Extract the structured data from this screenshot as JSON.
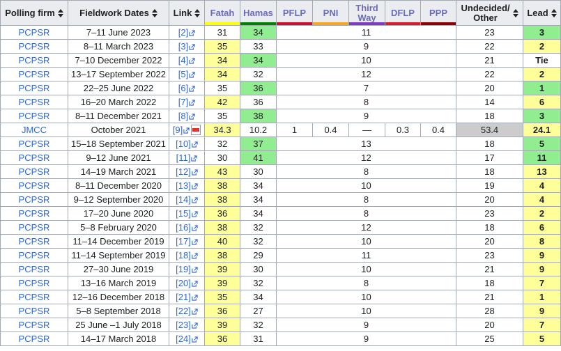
{
  "headers": {
    "firm": "Polling firm",
    "dates": "Fieldwork Dates",
    "link": "Link",
    "fatah": "Fatah",
    "hamas": "Hamas",
    "pflp": "PFLP",
    "pni": "PNI",
    "third_way": "Third Way",
    "dflp": "DFLP",
    "ppp": "PPP",
    "undecided": "Undecided/ Other",
    "lead": "Lead"
  },
  "party_colors": {
    "fatah": "#ffff00",
    "hamas": "#008000",
    "pflp": "#c8102e",
    "pni": "#f5a623",
    "third_way": "#7e3bbd",
    "dflp": "#d41c2a",
    "ppp": "#8b0000"
  },
  "highlight_colors": {
    "fatah": "#ffff99",
    "hamas": "#90ee90",
    "undecided": "#cccccc"
  },
  "rows": [
    {
      "firm": "PCPSR",
      "dates": "7–11 June 2023",
      "link": "[2]",
      "fatah": "31",
      "hamas": "34",
      "others": "11",
      "undecided": "23",
      "lead": "3",
      "leader": "hamas"
    },
    {
      "firm": "PCPSR",
      "dates": "8–11 March 2023",
      "link": "[3]",
      "fatah": "35",
      "hamas": "33",
      "others": "9",
      "undecided": "22",
      "lead": "2",
      "leader": "fatah"
    },
    {
      "firm": "PCPSR",
      "dates": "7–10 December 2022",
      "link": "[4]",
      "fatah": "34",
      "hamas": "34",
      "others": "10",
      "undecided": "21",
      "lead": "Tie",
      "leader": "tie"
    },
    {
      "firm": "PCPSR",
      "dates": "13–17 September 2022",
      "link": "[5]",
      "fatah": "34",
      "hamas": "32",
      "others": "12",
      "undecided": "22",
      "lead": "2",
      "leader": "fatah"
    },
    {
      "firm": "PCPSR",
      "dates": "22–25 June 2022",
      "link": "[6]",
      "fatah": "35",
      "hamas": "36",
      "others": "7",
      "undecided": "20",
      "lead": "1",
      "leader": "hamas"
    },
    {
      "firm": "PCPSR",
      "dates": "16–20 March 2022",
      "link": "[7]",
      "fatah": "42",
      "hamas": "36",
      "others": "8",
      "undecided": "14",
      "lead": "6",
      "leader": "fatah"
    },
    {
      "firm": "PCPSR",
      "dates": "8–11 December 2021",
      "link": "[8]",
      "fatah": "35",
      "hamas": "38",
      "others": "9",
      "undecided": "18",
      "lead": "3",
      "leader": "hamas"
    },
    {
      "firm": "JMCC",
      "dates": "October 2021",
      "link": "[9]",
      "pdf": true,
      "fatah": "34.3",
      "hamas": "10.2",
      "pflp": "1",
      "pni": "0.4",
      "third_way": "—",
      "dflp": "0.3",
      "ppp": "0.4",
      "undecided": "53.4",
      "lead": "24.1",
      "leader": "fatah",
      "split": true
    },
    {
      "firm": "PCPSR",
      "dates": "15–18 September 2021",
      "link": "[10]",
      "fatah": "32",
      "hamas": "37",
      "others": "13",
      "undecided": "18",
      "lead": "5",
      "leader": "hamas"
    },
    {
      "firm": "PCPSR",
      "dates": "9–12 June 2021",
      "link": "[11]",
      "fatah": "30",
      "hamas": "41",
      "others": "12",
      "undecided": "17",
      "lead": "11",
      "leader": "hamas"
    },
    {
      "firm": "PCPSR",
      "dates": "14–19 March 2021",
      "link": "[12]",
      "fatah": "43",
      "hamas": "30",
      "others": "8",
      "undecided": "18",
      "lead": "13",
      "leader": "fatah"
    },
    {
      "firm": "PCPSR",
      "dates": "8–11 December 2020",
      "link": "[13]",
      "fatah": "38",
      "hamas": "34",
      "others": "10",
      "undecided": "19",
      "lead": "4",
      "leader": "fatah"
    },
    {
      "firm": "PCPSR",
      "dates": "9–12 September 2020",
      "link": "[14]",
      "fatah": "38",
      "hamas": "34",
      "others": "8",
      "undecided": "20",
      "lead": "4",
      "leader": "fatah"
    },
    {
      "firm": "PCPSR",
      "dates": "17–20 June 2020",
      "link": "[15]",
      "fatah": "36",
      "hamas": "34",
      "others": "8",
      "undecided": "23",
      "lead": "2",
      "leader": "fatah"
    },
    {
      "firm": "PCPSR",
      "dates": "5–8 February 2020",
      "link": "[16]",
      "fatah": "38",
      "hamas": "32",
      "others": "12",
      "undecided": "18",
      "lead": "6",
      "leader": "fatah"
    },
    {
      "firm": "PCPSR",
      "dates": "11–14 December 2019",
      "link": "[17]",
      "fatah": "40",
      "hamas": "32",
      "others": "10",
      "undecided": "20",
      "lead": "8",
      "leader": "fatah"
    },
    {
      "firm": "PCPSR",
      "dates": "11–14 September 2019",
      "link": "[18]",
      "fatah": "38",
      "hamas": "29",
      "others": "11",
      "undecided": "23",
      "lead": "9",
      "leader": "fatah"
    },
    {
      "firm": "PCPSR",
      "dates": "27–30 June 2019",
      "link": "[19]",
      "fatah": "39",
      "hamas": "30",
      "others": "10",
      "undecided": "21",
      "lead": "9",
      "leader": "fatah"
    },
    {
      "firm": "PCPSR",
      "dates": "13–16 March 2019",
      "link": "[20]",
      "fatah": "39",
      "hamas": "32",
      "others": "8",
      "undecided": "18",
      "lead": "7",
      "leader": "fatah"
    },
    {
      "firm": "PCPSR",
      "dates": "12–16 December 2018",
      "link": "[21]",
      "fatah": "35",
      "hamas": "34",
      "others": "10",
      "undecided": "21",
      "lead": "1",
      "leader": "fatah"
    },
    {
      "firm": "PCPSR",
      "dates": "5–8 September 2018",
      "link": "[22]",
      "fatah": "36",
      "hamas": "27",
      "others": "10",
      "undecided": "28",
      "lead": "9",
      "leader": "fatah"
    },
    {
      "firm": "PCPSR",
      "dates": "25 June –1 July 2018",
      "link": "[23]",
      "fatah": "39",
      "hamas": "32",
      "others": "9",
      "undecided": "20",
      "lead": "7",
      "leader": "fatah"
    },
    {
      "firm": "PCPSR",
      "dates": "14–17 March 2018",
      "link": "[24]",
      "fatah": "36",
      "hamas": "31",
      "others": "9",
      "undecided": "25",
      "lead": "5",
      "leader": "fatah"
    }
  ]
}
